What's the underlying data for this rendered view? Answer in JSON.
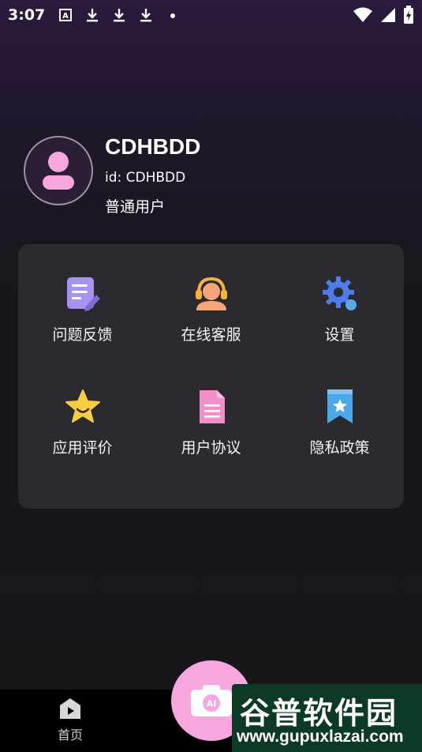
{
  "status_bar": {
    "time": "3:07",
    "left_icons": [
      "text-a-icon",
      "download-icon",
      "download-icon",
      "download-icon",
      "dot-icon"
    ],
    "right_icons": [
      "wifi-icon",
      "signal-icon",
      "battery-icon"
    ]
  },
  "profile": {
    "username": "CDHBDD",
    "user_id": "id: CDHBDD",
    "user_type": "普通用户"
  },
  "menu": {
    "items": [
      {
        "label": "问题反馈",
        "icon": "feedback-icon",
        "color": "#a991f0"
      },
      {
        "label": "在线客服",
        "icon": "customer-service-icon",
        "color": "#f6a47a"
      },
      {
        "label": "设置",
        "icon": "gear-icon",
        "color": "#4c7cf0"
      },
      {
        "label": "应用评价",
        "icon": "star-icon",
        "color": "#f9cd3f"
      },
      {
        "label": "用户协议",
        "icon": "document-icon",
        "color": "#f48ecb"
      },
      {
        "label": "隐私政策",
        "icon": "bookmark-icon",
        "color": "#4aa8ec"
      }
    ]
  },
  "bottom_nav": {
    "home_label": "首页",
    "fab_label": "AI"
  },
  "watermark": {
    "name": "谷普软件园",
    "url": "www.gupuxlazai.com"
  }
}
